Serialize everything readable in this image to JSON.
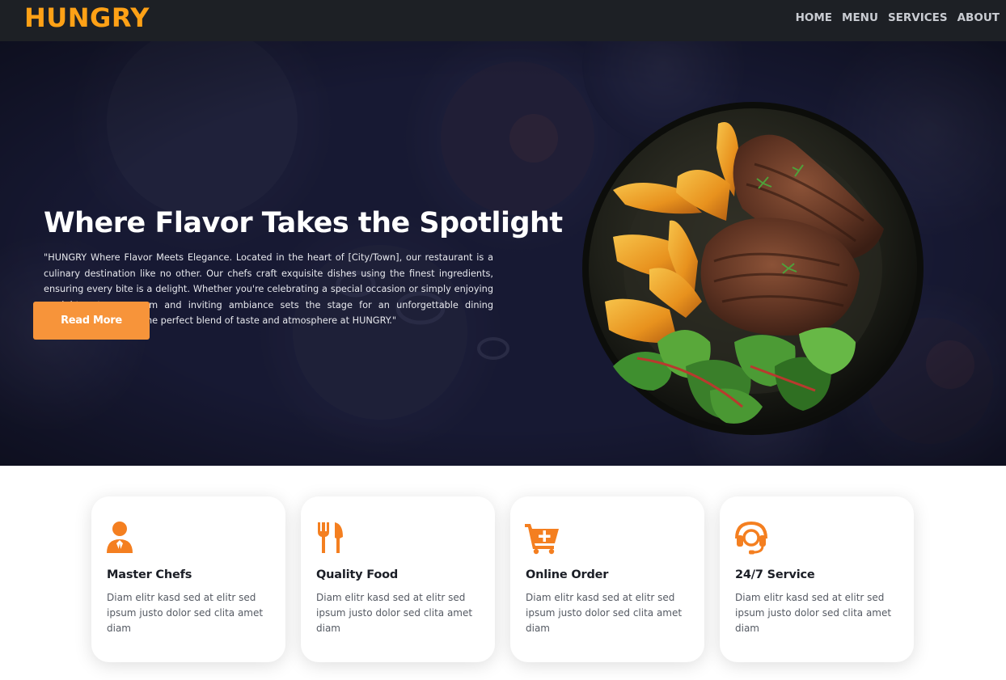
{
  "brand": "HUNGRY",
  "nav": [
    {
      "label": "HOME"
    },
    {
      "label": "MENU"
    },
    {
      "label": "SERVICES"
    },
    {
      "label": "ABOUT"
    }
  ],
  "hero": {
    "title": "Where Flavor Takes the Spotlight",
    "text": "\"HUNGRY Where Flavor Meets Elegance. Located in the heart of [City/Town], our restaurant is a culinary destination like no other. Our chefs craft exquisite dishes using the finest ingredients, ensuring every bite is a delight. Whether you're celebrating a special occasion or simply enjoying a night out, our warm and inviting ambiance sets the stage for an unforgettable dining experience. Discover the perfect blend of taste and atmosphere at HUNGRY.\"",
    "button_label": "Read More"
  },
  "features": [
    {
      "icon": "chef-icon",
      "title": "Master Chefs",
      "text": "Diam elitr kasd sed at elitr sed ipsum justo dolor sed clita amet diam"
    },
    {
      "icon": "utensils-icon",
      "title": "Quality Food",
      "text": "Diam elitr kasd sed at elitr sed ipsum justo dolor sed clita amet diam"
    },
    {
      "icon": "cart-plus-icon",
      "title": "Online Order",
      "text": "Diam elitr kasd sed at elitr sed ipsum justo dolor sed clita amet diam"
    },
    {
      "icon": "headset-icon",
      "title": "24/7 Service",
      "text": "Diam elitr kasd sed at elitr sed ipsum justo dolor sed clita amet diam"
    }
  ],
  "colors": {
    "accent": "#fea116",
    "button": "#f7943a",
    "icon": "#f47f20",
    "navbar": "#1d2025",
    "hero_overlay": "#17192f"
  }
}
